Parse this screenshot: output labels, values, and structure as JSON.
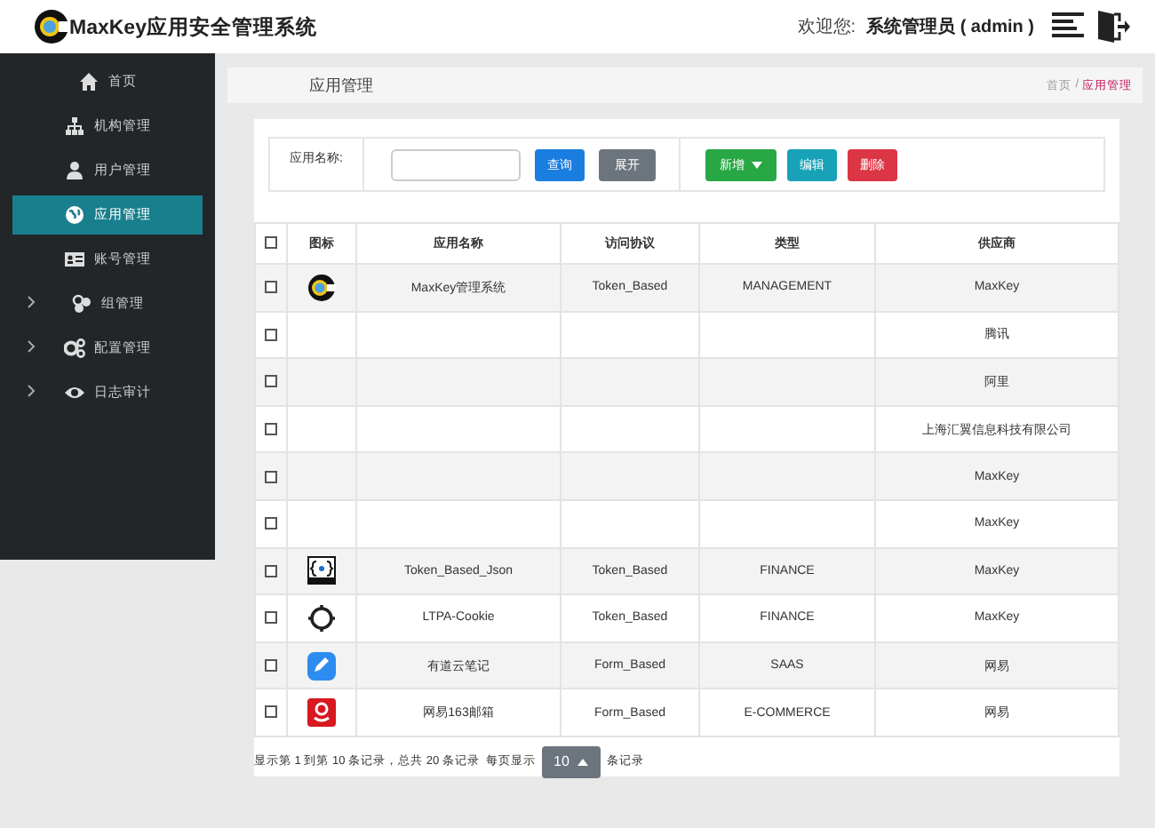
{
  "header": {
    "app_title": "MaxKey应用安全管理系统",
    "welcome": "欢迎您:",
    "user": "系统管理员 ( admin )"
  },
  "sidebar": {
    "items": [
      {
        "label": "首页",
        "kind": "home",
        "selected": false,
        "expandable": false
      },
      {
        "label": "机构管理",
        "kind": "org",
        "selected": false,
        "expandable": false
      },
      {
        "label": "用户管理",
        "kind": "user",
        "selected": false,
        "expandable": false
      },
      {
        "label": "应用管理",
        "kind": "globe",
        "selected": true,
        "expandable": false
      },
      {
        "label": "账号管理",
        "kind": "card",
        "selected": false,
        "expandable": false
      },
      {
        "label": "组管理",
        "kind": "group",
        "selected": false,
        "expandable": true
      },
      {
        "label": "配置管理",
        "kind": "gears",
        "selected": false,
        "expandable": true
      },
      {
        "label": "日志审计",
        "kind": "eye",
        "selected": false,
        "expandable": true
      }
    ]
  },
  "page": {
    "title": "应用管理",
    "breadcrumb": [
      "首页",
      "应用管理"
    ],
    "breadcrumb_separator": "/"
  },
  "search": {
    "label": "应用名称:",
    "buttons": [
      {
        "label": "查询",
        "kind": "primary",
        "dropdown": false
      },
      {
        "label": "展开",
        "kind": "secondary",
        "dropdown": false
      },
      {
        "label": "新增",
        "kind": "success",
        "dropdown": true
      },
      {
        "label": "编辑",
        "kind": "info",
        "dropdown": false
      },
      {
        "label": "删除",
        "kind": "danger",
        "dropdown": false
      }
    ]
  },
  "table": {
    "select_all_checked": false,
    "columns": [
      "图标",
      "应用名称",
      "访问协议",
      "类型",
      "供应商"
    ],
    "rows": [
      {
        "checked": false,
        "kind": "maxkey",
        "name": "MaxKey管理系统",
        "protocol": "Token_Based",
        "type": "MANAGEMENT",
        "vendor": "MaxKey"
      },
      {
        "checked": false,
        "vendor": "腾讯"
      },
      {
        "checked": false,
        "vendor": "阿里"
      },
      {
        "checked": false,
        "vendor": "上海汇翼信息科技有限公司"
      },
      {
        "checked": false,
        "vendor": "MaxKey"
      },
      {
        "checked": false,
        "vendor": "MaxKey"
      },
      {
        "checked": false,
        "kind": "json",
        "name": "Token_Based_Json",
        "protocol": "Token_Based",
        "type": "FINANCE",
        "vendor": "MaxKey"
      },
      {
        "checked": false,
        "kind": "ring",
        "name": "LTPA-Cookie",
        "protocol": "Token_Based",
        "type": "FINANCE",
        "vendor": "MaxKey"
      },
      {
        "checked": false,
        "kind": "note",
        "name": "有道云笔记",
        "protocol": "Form_Based",
        "type": "SAAS",
        "vendor": "网易"
      },
      {
        "checked": false,
        "kind": "mail",
        "name": "网易163邮箱",
        "protocol": "Form_Based",
        "type": "E-COMMERCE",
        "vendor": "网易"
      }
    ]
  },
  "pagination": {
    "summary": "显示第 1 到第 10 条记录，总共 20 条记录  每页显示",
    "page_size": "10",
    "suffix": "条记录"
  }
}
